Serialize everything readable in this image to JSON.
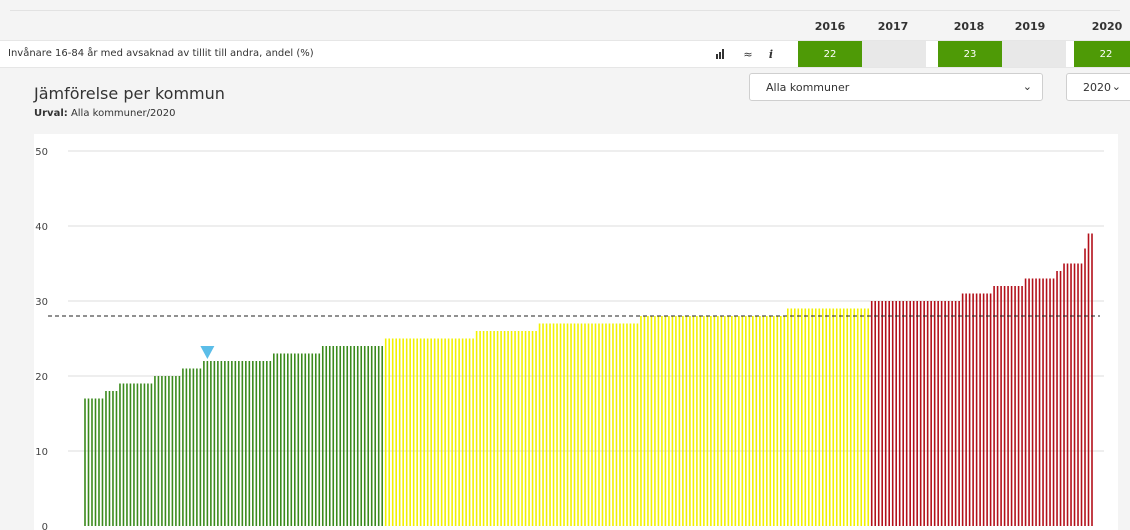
{
  "header": {
    "years": [
      "2016",
      "2017",
      "2018",
      "2019",
      "2020"
    ]
  },
  "indicator": {
    "label": "Invånare 16-84 år med avsaknad av tillit till andra, andel (%)",
    "tools": [
      "bar-chart-icon",
      "trend-icon",
      "info-icon"
    ],
    "tool_glyphs": [
      "▐▌",
      "≈",
      "i"
    ],
    "values": [
      {
        "year": "2016",
        "value": "22",
        "color": "#4e9a06"
      },
      {
        "year": "2017",
        "value": "",
        "color": "#e8e8e8"
      },
      {
        "year": "2018",
        "value": "23",
        "color": "#4e9a06"
      },
      {
        "year": "2019",
        "value": "",
        "color": "#e8e8e8"
      },
      {
        "year": "2020",
        "value": "22",
        "color": "#4e9a06"
      }
    ]
  },
  "section": {
    "title": "Jämförelse per kommun",
    "urval_label": "Urval:",
    "urval_value": "Alla kommuner/2020"
  },
  "filters": {
    "municipality": "Alla kommuner",
    "year": "2020"
  },
  "colors": {
    "green": "#3a8a1c",
    "yellow": "#f2f200",
    "red": "#b3101a",
    "marker": "#5bbde8",
    "cell_green": "#4e9a06",
    "cell_empty": "#e8e8e8"
  },
  "chart_data": {
    "type": "bar",
    "ylim": [
      0,
      50
    ],
    "yticks": [
      0,
      10,
      20,
      30,
      40,
      50
    ],
    "reference_line": 28,
    "marker_value": 22,
    "marker_index": 35,
    "series": [
      {
        "color_key": "green",
        "values": [
          17,
          17,
          17,
          17,
          17,
          17,
          18,
          18,
          18,
          18,
          19,
          19,
          19,
          19,
          19,
          19,
          19,
          19,
          19,
          19,
          20,
          20,
          20,
          20,
          20,
          20,
          20,
          20,
          21,
          21,
          21,
          21,
          21,
          21,
          22,
          22,
          22,
          22,
          22,
          22,
          22,
          22,
          22,
          22,
          22,
          22,
          22,
          22,
          22,
          22,
          22,
          22,
          22,
          22,
          23,
          23,
          23,
          23,
          23,
          23,
          23,
          23,
          23,
          23,
          23,
          23,
          23,
          23,
          24,
          24,
          24,
          24,
          24,
          24,
          24,
          24,
          24,
          24,
          24,
          24,
          24,
          24,
          24,
          24,
          24,
          24
        ]
      },
      {
        "color_key": "yellow",
        "values": [
          25,
          25,
          25,
          25,
          25,
          25,
          25,
          25,
          25,
          25,
          25,
          25,
          25,
          25,
          25,
          25,
          25,
          25,
          25,
          25,
          25,
          25,
          25,
          25,
          25,
          25,
          26,
          26,
          26,
          26,
          26,
          26,
          26,
          26,
          26,
          26,
          26,
          26,
          26,
          26,
          26,
          26,
          26,
          26,
          27,
          27,
          27,
          27,
          27,
          27,
          27,
          27,
          27,
          27,
          27,
          27,
          27,
          27,
          27,
          27,
          27,
          27,
          27,
          27,
          27,
          27,
          27,
          27,
          27,
          27,
          27,
          27,
          27,
          28,
          28,
          28,
          28,
          28,
          28,
          28,
          28,
          28,
          28,
          28,
          28,
          28,
          28,
          28,
          28,
          28,
          28,
          28,
          28,
          28,
          28,
          28,
          28,
          28,
          28,
          28,
          28,
          28,
          28,
          28,
          28,
          28,
          28,
          28,
          28,
          28,
          28,
          28,
          28,
          28,
          28,
          29,
          29,
          29,
          29,
          29,
          29,
          29,
          29,
          29,
          29,
          29,
          29,
          29,
          29,
          29,
          29,
          29,
          29,
          29,
          29,
          29,
          29,
          29,
          29
        ]
      },
      {
        "color_key": "red",
        "values": [
          30,
          30,
          30,
          30,
          30,
          30,
          30,
          30,
          30,
          30,
          30,
          30,
          30,
          30,
          30,
          30,
          30,
          30,
          30,
          30,
          30,
          30,
          30,
          30,
          30,
          30,
          31,
          31,
          31,
          31,
          31,
          31,
          31,
          31,
          31,
          32,
          32,
          32,
          32,
          32,
          32,
          32,
          32,
          32,
          33,
          33,
          33,
          33,
          33,
          33,
          33,
          33,
          33,
          34,
          34,
          35,
          35,
          35,
          35,
          35,
          35,
          37,
          39,
          39
        ]
      }
    ]
  }
}
